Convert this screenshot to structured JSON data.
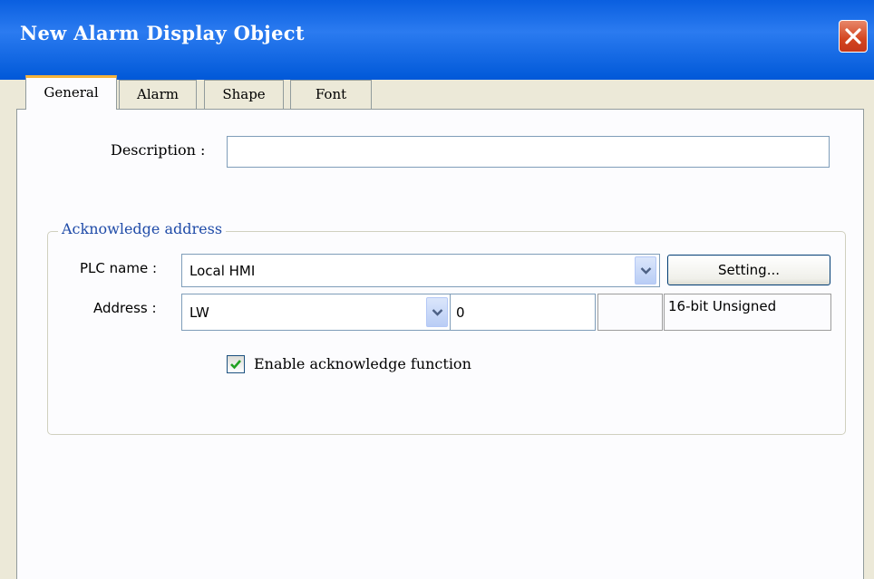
{
  "window": {
    "title": "New  Alarm Display Object",
    "close_icon": "close-x-icon"
  },
  "tabs": [
    {
      "label": "General",
      "active": true
    },
    {
      "label": "Alarm",
      "active": false
    },
    {
      "label": "Shape",
      "active": false
    },
    {
      "label": "Font",
      "active": false
    }
  ],
  "general": {
    "description_label": "Description :",
    "description_value": ""
  },
  "ack_group": {
    "title": "Acknowledge address",
    "plc_name_label": "PLC name :",
    "plc_name_value": "Local HMI",
    "setting_button": "Setting...",
    "address_label": "Address :",
    "address_device": "LW",
    "address_value": "0",
    "address_extra": "",
    "data_format": "16-bit Unsigned",
    "enable_ack_label": "Enable acknowledge function",
    "enable_ack_checked": true
  },
  "colors": {
    "title_bar": "#0a5fe0",
    "active_tab_accent": "#f5b33a",
    "group_title": "#1f4ba8",
    "check_mark": "#21a121"
  }
}
